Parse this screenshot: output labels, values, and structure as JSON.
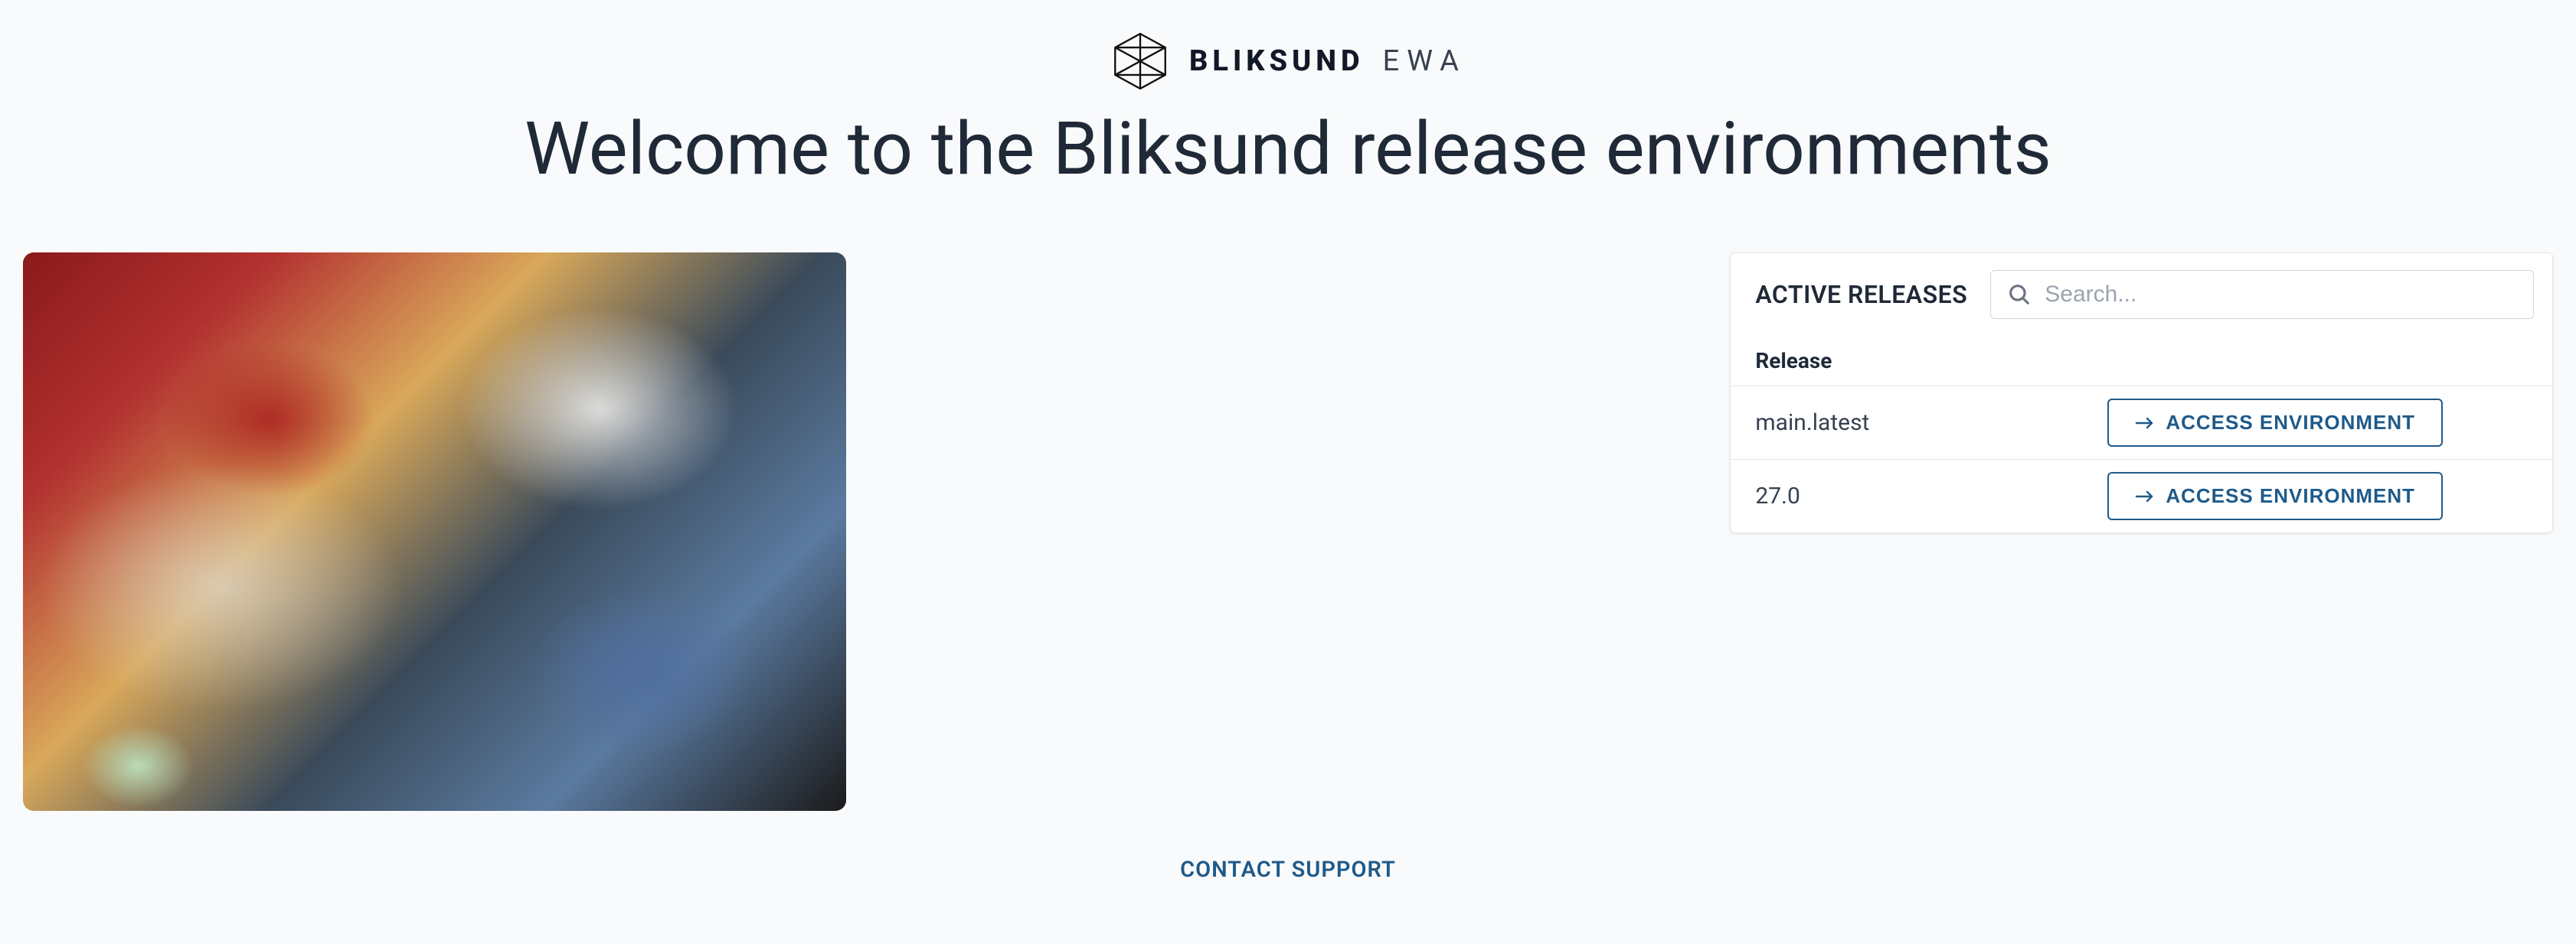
{
  "brand": {
    "name": "BLIKSUND",
    "suffix": "EWA"
  },
  "welcome_title": "Welcome to the Bliksund release environments",
  "releases": {
    "title": "ACTIVE RELEASES",
    "search_placeholder": "Search...",
    "column_header": "Release",
    "items": [
      {
        "name": "main.latest",
        "button_label": "ACCESS ENVIRONMENT"
      },
      {
        "name": "27.0",
        "button_label": "ACCESS ENVIRONMENT"
      }
    ]
  },
  "footer": {
    "contact_label": "CONTACT SUPPORT"
  }
}
